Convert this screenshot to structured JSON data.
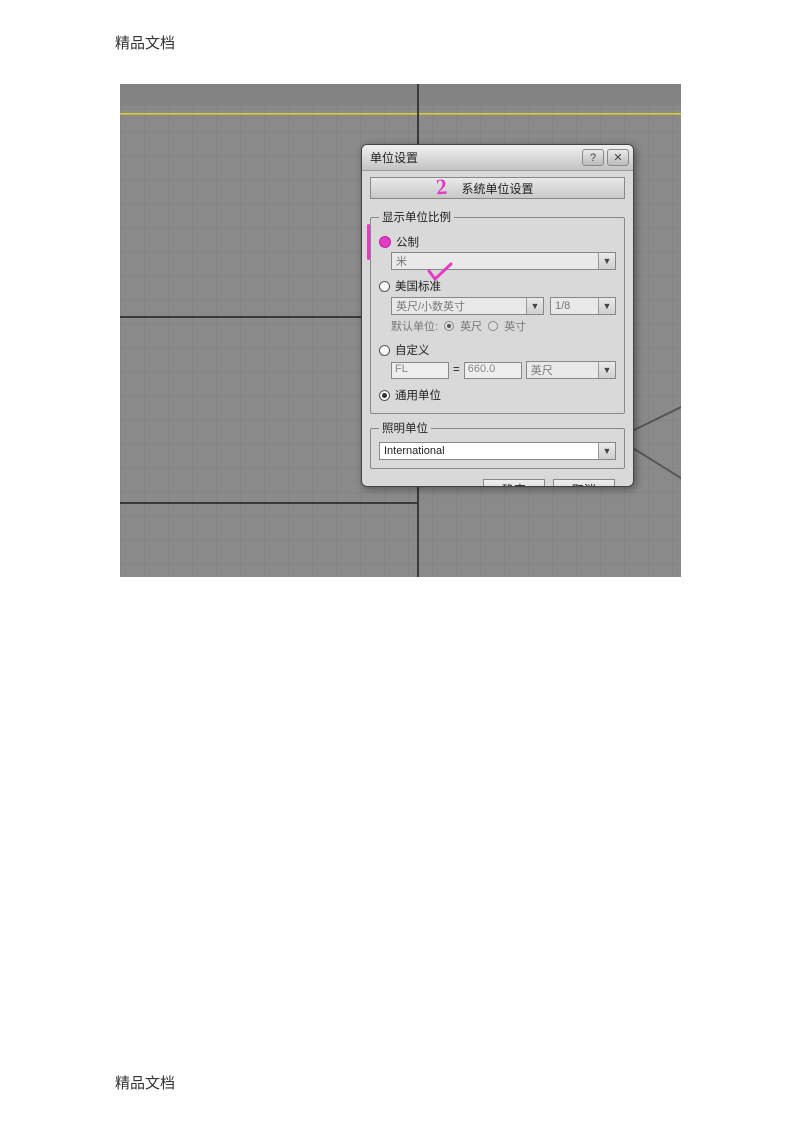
{
  "header_text": "精品文档",
  "footer_text": "精品文档",
  "dialog": {
    "title": "单位设置",
    "system_units_button": "系统单位设置",
    "display_scale_group": "显示单位比例",
    "metric_label": "公制",
    "metric_combo": "米",
    "us_label": "美国标准",
    "us_combo1": "英尺/小数英寸",
    "us_combo2": "1/8",
    "default_unit_label": "默认单位:",
    "default_unit_opt1": "英尺",
    "default_unit_opt2": "英寸",
    "custom_label": "自定义",
    "custom_prefix": "FL",
    "custom_eq": "=",
    "custom_value": "660.0",
    "custom_unit": "英尺",
    "generic_label": "通用单位",
    "lighting_group": "照明单位",
    "lighting_combo": "International",
    "ok": "确定",
    "cancel": "取消"
  },
  "annotations": {
    "two": "2"
  }
}
